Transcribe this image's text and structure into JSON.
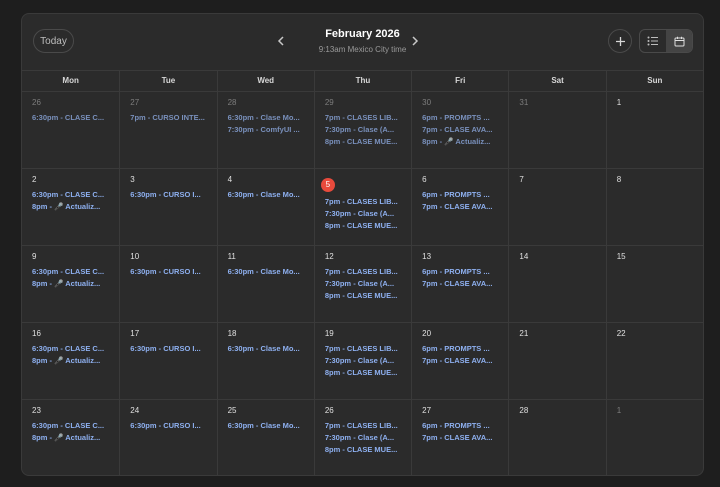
{
  "header": {
    "today_label": "Today",
    "month_title": "February 2026",
    "timezone_line": "9:13am Mexico City time",
    "prev_icon": "chevron-left-icon",
    "next_icon": "chevron-right-icon",
    "add_icon": "plus-icon",
    "view_list_icon": "list-icon",
    "view_month_icon": "calendar-icon",
    "active_view": "month"
  },
  "colors": {
    "background": "#1e1e1e",
    "card": "#2b2b2b",
    "event_text": "#8eb0f0",
    "today_badge": "#e84a3c"
  },
  "weekdays": [
    "Mon",
    "Tue",
    "Wed",
    "Thu",
    "Fri",
    "Sat",
    "Sun"
  ],
  "weeks": [
    [
      {
        "day": "26",
        "other": true,
        "events": [
          "6:30pm - CLASE C..."
        ]
      },
      {
        "day": "27",
        "other": true,
        "events": [
          "7pm - CURSO INTE..."
        ]
      },
      {
        "day": "28",
        "other": true,
        "events": [
          "6:30pm - Clase Mo...",
          "7:30pm - ComfyUI ..."
        ]
      },
      {
        "day": "29",
        "other": true,
        "events": [
          "7pm - CLASES LIB...",
          "7:30pm - Clase (A...",
          "8pm - CLASE MUE..."
        ]
      },
      {
        "day": "30",
        "other": true,
        "events": [
          "6pm - PROMPTS ...",
          "7pm - CLASE AVA...",
          "8pm - 🎤 Actualiz..."
        ]
      },
      {
        "day": "31",
        "other": true,
        "events": []
      },
      {
        "day": "1",
        "other": false,
        "events": []
      }
    ],
    [
      {
        "day": "2",
        "other": false,
        "events": [
          "6:30pm - CLASE C...",
          "8pm - 🎤 Actualiz..."
        ]
      },
      {
        "day": "3",
        "other": false,
        "events": [
          "6:30pm - CURSO I..."
        ]
      },
      {
        "day": "4",
        "other": false,
        "events": [
          "6:30pm - Clase Mo..."
        ]
      },
      {
        "day": "5",
        "other": false,
        "today": true,
        "events": [
          "7pm - CLASES LIB...",
          "7:30pm - Clase (A...",
          "8pm - CLASE MUE..."
        ]
      },
      {
        "day": "6",
        "other": false,
        "events": [
          "6pm - PROMPTS ...",
          "7pm - CLASE AVA..."
        ]
      },
      {
        "day": "7",
        "other": false,
        "events": []
      },
      {
        "day": "8",
        "other": false,
        "events": []
      }
    ],
    [
      {
        "day": "9",
        "other": false,
        "events": [
          "6:30pm - CLASE C...",
          "8pm - 🎤 Actualiz..."
        ]
      },
      {
        "day": "10",
        "other": false,
        "events": [
          "6:30pm - CURSO I..."
        ]
      },
      {
        "day": "11",
        "other": false,
        "events": [
          "6:30pm - Clase Mo..."
        ]
      },
      {
        "day": "12",
        "other": false,
        "events": [
          "7pm - CLASES LIB...",
          "7:30pm - Clase (A...",
          "8pm - CLASE MUE..."
        ]
      },
      {
        "day": "13",
        "other": false,
        "events": [
          "6pm - PROMPTS ...",
          "7pm - CLASE AVA..."
        ]
      },
      {
        "day": "14",
        "other": false,
        "events": []
      },
      {
        "day": "15",
        "other": false,
        "events": []
      }
    ],
    [
      {
        "day": "16",
        "other": false,
        "events": [
          "6:30pm - CLASE C...",
          "8pm - 🎤 Actualiz..."
        ]
      },
      {
        "day": "17",
        "other": false,
        "events": [
          "6:30pm - CURSO I..."
        ]
      },
      {
        "day": "18",
        "other": false,
        "events": [
          "6:30pm - Clase Mo..."
        ]
      },
      {
        "day": "19",
        "other": false,
        "events": [
          "7pm - CLASES LIB...",
          "7:30pm - Clase (A...",
          "8pm - CLASE MUE..."
        ]
      },
      {
        "day": "20",
        "other": false,
        "events": [
          "6pm - PROMPTS ...",
          "7pm - CLASE AVA..."
        ]
      },
      {
        "day": "21",
        "other": false,
        "events": []
      },
      {
        "day": "22",
        "other": false,
        "events": []
      }
    ],
    [
      {
        "day": "23",
        "other": false,
        "events": [
          "6:30pm - CLASE C...",
          "8pm - 🎤 Actualiz..."
        ]
      },
      {
        "day": "24",
        "other": false,
        "events": [
          "6:30pm - CURSO I..."
        ]
      },
      {
        "day": "25",
        "other": false,
        "events": [
          "6:30pm - Clase Mo..."
        ]
      },
      {
        "day": "26",
        "other": false,
        "events": [
          "7pm - CLASES LIB...",
          "7:30pm - Clase (A...",
          "8pm - CLASE MUE..."
        ]
      },
      {
        "day": "27",
        "other": false,
        "events": [
          "6pm - PROMPTS ...",
          "7pm - CLASE AVA..."
        ]
      },
      {
        "day": "28",
        "other": false,
        "events": []
      },
      {
        "day": "1",
        "other": true,
        "events": []
      }
    ]
  ]
}
